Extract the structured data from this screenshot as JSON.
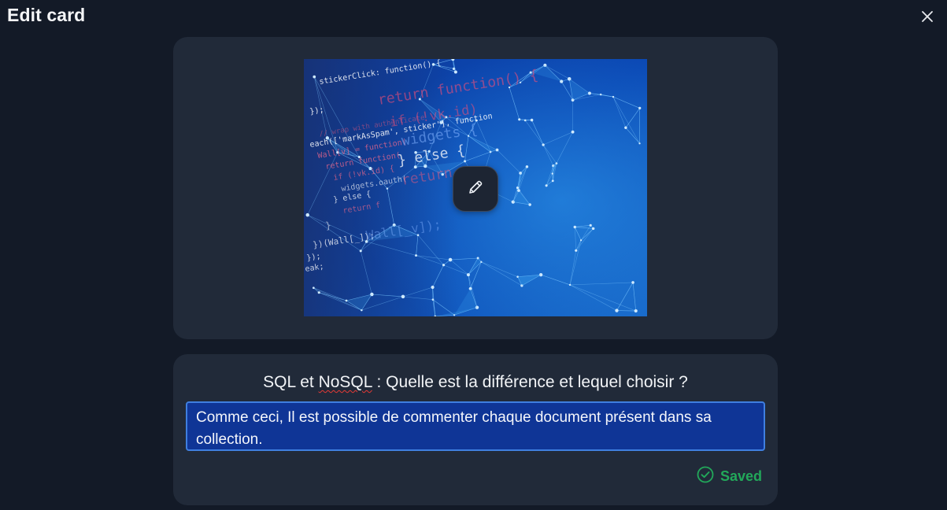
{
  "dialog": {
    "title": "Edit card"
  },
  "card": {
    "title_before": "SQL et ",
    "title_misspelled": "NoSQL",
    "title_after": " : Quelle est la différence et lequel choisir ?",
    "description": "Comme ceci, Il est possible de commenter chaque document présent dans sa collection."
  },
  "status": {
    "label": "Saved",
    "color": "#22a85a"
  },
  "icons": {
    "close": "close-icon",
    "edit": "pencil-icon",
    "saved": "check-circle-icon"
  },
  "image_code_text": [
    "stickerClick: function() {",
    "});",
    "// wrap with authenticate",
    "each(['markAsSpam', sticker'], function",
    "Wall[v] = function(",
    "return function(",
    "if (!vk.id) {",
    "widgets.oauth(",
    "} else {",
    "return f",
    "}",
    "})(Wall[_]);",
    "});",
    "eak;",
    "return function() {",
    "if (!vk.id)",
    "widgets {",
    "} else {",
    "return",
    "Wall[_v]);"
  ]
}
